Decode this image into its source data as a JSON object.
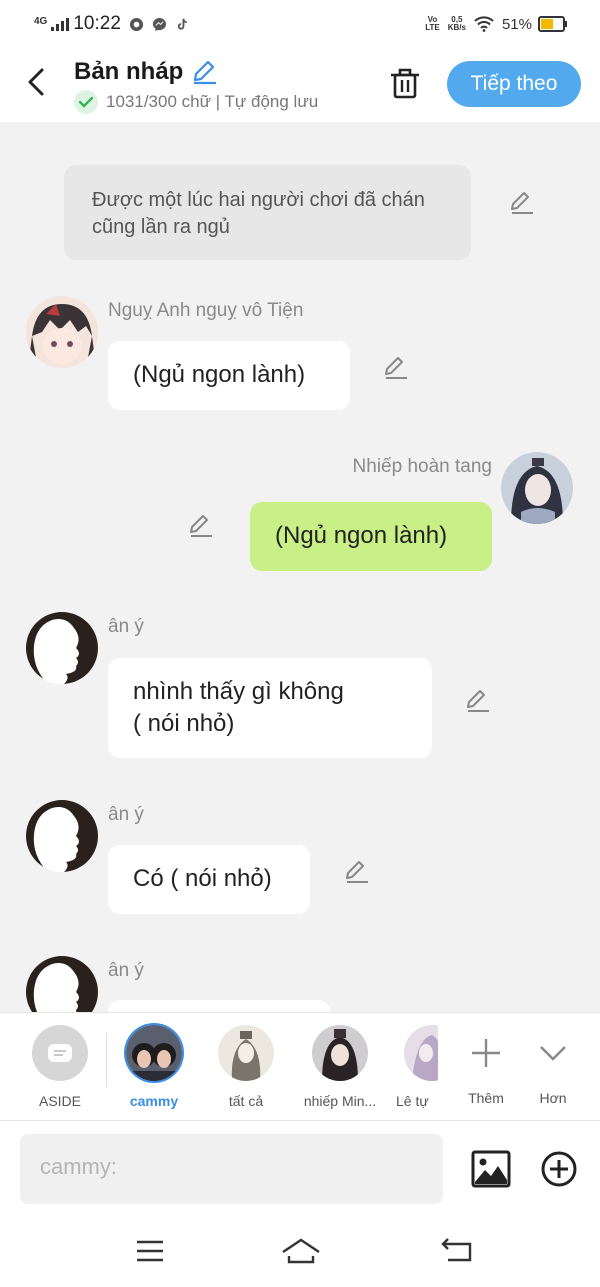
{
  "status_bar": {
    "network": "4G",
    "time": "10:22",
    "volte": "Vo\nLTE",
    "speed": "0,5\nKB/s",
    "battery": "51%"
  },
  "header": {
    "title": "Bản nháp",
    "subtitle": "1031/300 chữ | Tự động lưu",
    "next_label": "Tiếp theo"
  },
  "messages": [
    {
      "type": "narration",
      "text": "Được một lúc hai người chơi đã chán cũng lần ra ngủ"
    },
    {
      "type": "left",
      "name": "Nguỵ Anh nguỵ vô Tiện",
      "text": "(Ngủ ngon lành)"
    },
    {
      "type": "right",
      "name": "Nhiếp hoàn tang",
      "text": "(Ngủ ngon lành)"
    },
    {
      "type": "left",
      "name": "ân ý",
      "text": "nhình thấy gì không\n( nói nhỏ)"
    },
    {
      "type": "left",
      "name": "ân ý",
      "text": "Có ( nói nhỏ)"
    },
    {
      "type": "left",
      "name": "ân ý",
      "text": ""
    }
  ],
  "characters": [
    {
      "label": "ASIDE"
    },
    {
      "label": "cammy",
      "selected": true
    },
    {
      "label": "tất cả"
    },
    {
      "label": "nhiếp Min..."
    },
    {
      "label": "Lê tự"
    },
    {
      "label": "Thêm"
    },
    {
      "label": "Hơn"
    }
  ],
  "input": {
    "placeholder": "cammy:"
  },
  "colors": {
    "accent": "#53a9ee",
    "selected_char": "#3a8ee6",
    "right_bubble": "#c8f086",
    "background": "#f2f2f2"
  },
  "icons": [
    "back-icon",
    "edit-icon",
    "check-icon",
    "trash-icon",
    "image-icon",
    "add-circle-icon",
    "plus-icon",
    "chevron-down-icon",
    "menu-icon",
    "home-icon",
    "return-icon"
  ]
}
